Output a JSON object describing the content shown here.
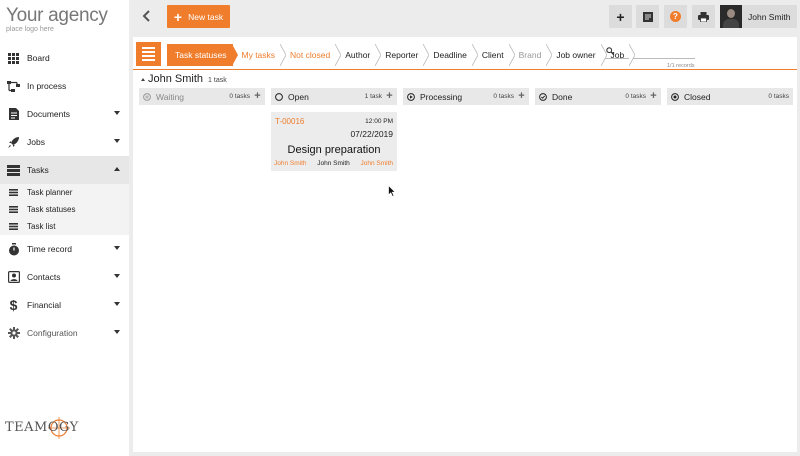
{
  "logo": {
    "main": "Your agency",
    "sub": "place logo here"
  },
  "sidebar": {
    "items": [
      {
        "label": "Board",
        "icon": "grid-icon"
      },
      {
        "label": "In process",
        "icon": "flow-icon"
      },
      {
        "label": "Documents",
        "icon": "document-icon",
        "expandable": true
      },
      {
        "label": "Jobs",
        "icon": "rocket-icon",
        "expandable": true
      },
      {
        "label": "Tasks",
        "icon": "tasks-icon",
        "expandable": true,
        "expanded": true
      },
      {
        "label": "Time record",
        "icon": "stopwatch-icon",
        "expandable": true
      },
      {
        "label": "Contacts",
        "icon": "contacts-icon",
        "expandable": true
      },
      {
        "label": "Financial",
        "icon": "dollar-icon",
        "expandable": true
      },
      {
        "label": "Configuration",
        "icon": "gear-icon",
        "expandable": true
      }
    ],
    "tasks_sub": [
      {
        "label": "Task planner"
      },
      {
        "label": "Task statuses"
      },
      {
        "label": "Task list"
      }
    ],
    "brand": "TEAMOGY"
  },
  "topbar": {
    "new_task_label": "New task",
    "user_name": "John Smith",
    "help_glyph": "?"
  },
  "filters": {
    "crumbs": [
      "Task statuses",
      "My tasks",
      "Not closed",
      "Author",
      "Reporter",
      "Deadline",
      "Client",
      "Brand",
      "Job owner",
      "Job"
    ],
    "search_placeholder": "",
    "records": "1/1 records"
  },
  "group": {
    "name": "John Smith",
    "count": "1 task"
  },
  "columns": [
    {
      "name": "Waiting",
      "count": "0 tasks",
      "has_add": true,
      "dim": true
    },
    {
      "name": "Open",
      "count": "1 task",
      "has_add": true
    },
    {
      "name": "Processing",
      "count": "0 tasks",
      "has_add": true
    },
    {
      "name": "Done",
      "count": "0 tasks",
      "has_add": true
    },
    {
      "name": "Closed",
      "count": "0 tasks",
      "has_add": false
    }
  ],
  "card": {
    "id": "T-00016",
    "time": "12:00 PM",
    "date": "07/22/2019",
    "title": "Design preparation",
    "people": [
      "John Smith",
      "John Smith",
      "John Smith"
    ]
  },
  "colors": {
    "accent": "#ef7d2c",
    "panel": "#ffffff",
    "background": "#ececec"
  }
}
